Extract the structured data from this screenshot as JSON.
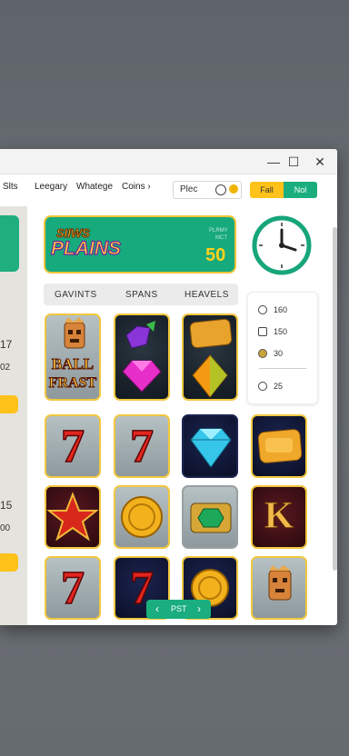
{
  "window": {
    "controls": [
      "—",
      "☐",
      "✕"
    ]
  },
  "nav": {
    "items": [
      "Slts",
      "Leegary",
      "Whatege",
      "Coins ›"
    ]
  },
  "search": {
    "value": "Plec",
    "icons": [
      "clock-icon",
      "coin-icon"
    ]
  },
  "toggle": {
    "left_label": "Fall",
    "right_label": "Nol"
  },
  "sidebar": {
    "values": [
      "17",
      "02",
      "15",
      "00"
    ]
  },
  "banner": {
    "logo_line1": "SIIWS",
    "logo_line2": "PLAINS",
    "small_line1": "PLRMY",
    "small_line2": "MCT",
    "value": "50"
  },
  "tabs": [
    "GAVINTS",
    "SPANS",
    "HEAVELS"
  ],
  "stats": [
    {
      "icon": "timer-icon",
      "value": "160"
    },
    {
      "icon": "copy-icon",
      "value": "150"
    },
    {
      "icon": "coin-icon",
      "value": "30"
    },
    {
      "icon": "clock-icon",
      "value": "25"
    }
  ],
  "tile_text": {
    "ball": "BALL",
    "frast": "FRAST",
    "k": "K",
    "seven": "7"
  },
  "pager": {
    "prev": "‹",
    "label": "PST",
    "next": "›"
  },
  "colors": {
    "accent_green": "#1aae7e",
    "gold": "#f1c73f",
    "yellow": "#ffc21a"
  }
}
